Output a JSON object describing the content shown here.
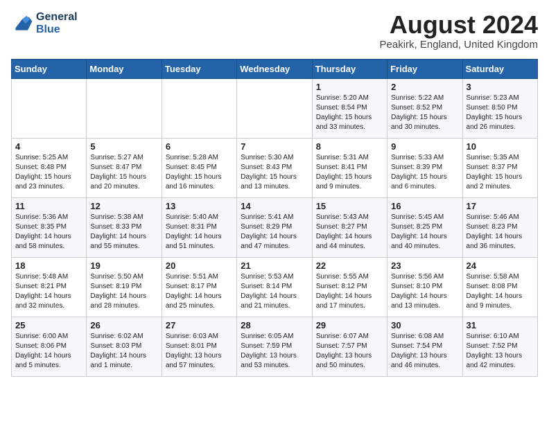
{
  "header": {
    "logo_line1": "General",
    "logo_line2": "Blue",
    "month_year": "August 2024",
    "location": "Peakirk, England, United Kingdom"
  },
  "weekdays": [
    "Sunday",
    "Monday",
    "Tuesday",
    "Wednesday",
    "Thursday",
    "Friday",
    "Saturday"
  ],
  "weeks": [
    [
      {
        "day": "",
        "info": ""
      },
      {
        "day": "",
        "info": ""
      },
      {
        "day": "",
        "info": ""
      },
      {
        "day": "",
        "info": ""
      },
      {
        "day": "1",
        "info": "Sunrise: 5:20 AM\nSunset: 8:54 PM\nDaylight: 15 hours\nand 33 minutes."
      },
      {
        "day": "2",
        "info": "Sunrise: 5:22 AM\nSunset: 8:52 PM\nDaylight: 15 hours\nand 30 minutes."
      },
      {
        "day": "3",
        "info": "Sunrise: 5:23 AM\nSunset: 8:50 PM\nDaylight: 15 hours\nand 26 minutes."
      }
    ],
    [
      {
        "day": "4",
        "info": "Sunrise: 5:25 AM\nSunset: 8:48 PM\nDaylight: 15 hours\nand 23 minutes."
      },
      {
        "day": "5",
        "info": "Sunrise: 5:27 AM\nSunset: 8:47 PM\nDaylight: 15 hours\nand 20 minutes."
      },
      {
        "day": "6",
        "info": "Sunrise: 5:28 AM\nSunset: 8:45 PM\nDaylight: 15 hours\nand 16 minutes."
      },
      {
        "day": "7",
        "info": "Sunrise: 5:30 AM\nSunset: 8:43 PM\nDaylight: 15 hours\nand 13 minutes."
      },
      {
        "day": "8",
        "info": "Sunrise: 5:31 AM\nSunset: 8:41 PM\nDaylight: 15 hours\nand 9 minutes."
      },
      {
        "day": "9",
        "info": "Sunrise: 5:33 AM\nSunset: 8:39 PM\nDaylight: 15 hours\nand 6 minutes."
      },
      {
        "day": "10",
        "info": "Sunrise: 5:35 AM\nSunset: 8:37 PM\nDaylight: 15 hours\nand 2 minutes."
      }
    ],
    [
      {
        "day": "11",
        "info": "Sunrise: 5:36 AM\nSunset: 8:35 PM\nDaylight: 14 hours\nand 58 minutes."
      },
      {
        "day": "12",
        "info": "Sunrise: 5:38 AM\nSunset: 8:33 PM\nDaylight: 14 hours\nand 55 minutes."
      },
      {
        "day": "13",
        "info": "Sunrise: 5:40 AM\nSunset: 8:31 PM\nDaylight: 14 hours\nand 51 minutes."
      },
      {
        "day": "14",
        "info": "Sunrise: 5:41 AM\nSunset: 8:29 PM\nDaylight: 14 hours\nand 47 minutes."
      },
      {
        "day": "15",
        "info": "Sunrise: 5:43 AM\nSunset: 8:27 PM\nDaylight: 14 hours\nand 44 minutes."
      },
      {
        "day": "16",
        "info": "Sunrise: 5:45 AM\nSunset: 8:25 PM\nDaylight: 14 hours\nand 40 minutes."
      },
      {
        "day": "17",
        "info": "Sunrise: 5:46 AM\nSunset: 8:23 PM\nDaylight: 14 hours\nand 36 minutes."
      }
    ],
    [
      {
        "day": "18",
        "info": "Sunrise: 5:48 AM\nSunset: 8:21 PM\nDaylight: 14 hours\nand 32 minutes."
      },
      {
        "day": "19",
        "info": "Sunrise: 5:50 AM\nSunset: 8:19 PM\nDaylight: 14 hours\nand 28 minutes."
      },
      {
        "day": "20",
        "info": "Sunrise: 5:51 AM\nSunset: 8:17 PM\nDaylight: 14 hours\nand 25 minutes."
      },
      {
        "day": "21",
        "info": "Sunrise: 5:53 AM\nSunset: 8:14 PM\nDaylight: 14 hours\nand 21 minutes."
      },
      {
        "day": "22",
        "info": "Sunrise: 5:55 AM\nSunset: 8:12 PM\nDaylight: 14 hours\nand 17 minutes."
      },
      {
        "day": "23",
        "info": "Sunrise: 5:56 AM\nSunset: 8:10 PM\nDaylight: 14 hours\nand 13 minutes."
      },
      {
        "day": "24",
        "info": "Sunrise: 5:58 AM\nSunset: 8:08 PM\nDaylight: 14 hours\nand 9 minutes."
      }
    ],
    [
      {
        "day": "25",
        "info": "Sunrise: 6:00 AM\nSunset: 8:06 PM\nDaylight: 14 hours\nand 5 minutes."
      },
      {
        "day": "26",
        "info": "Sunrise: 6:02 AM\nSunset: 8:03 PM\nDaylight: 14 hours\nand 1 minute."
      },
      {
        "day": "27",
        "info": "Sunrise: 6:03 AM\nSunset: 8:01 PM\nDaylight: 13 hours\nand 57 minutes."
      },
      {
        "day": "28",
        "info": "Sunrise: 6:05 AM\nSunset: 7:59 PM\nDaylight: 13 hours\nand 53 minutes."
      },
      {
        "day": "29",
        "info": "Sunrise: 6:07 AM\nSunset: 7:57 PM\nDaylight: 13 hours\nand 50 minutes."
      },
      {
        "day": "30",
        "info": "Sunrise: 6:08 AM\nSunset: 7:54 PM\nDaylight: 13 hours\nand 46 minutes."
      },
      {
        "day": "31",
        "info": "Sunrise: 6:10 AM\nSunset: 7:52 PM\nDaylight: 13 hours\nand 42 minutes."
      }
    ]
  ]
}
